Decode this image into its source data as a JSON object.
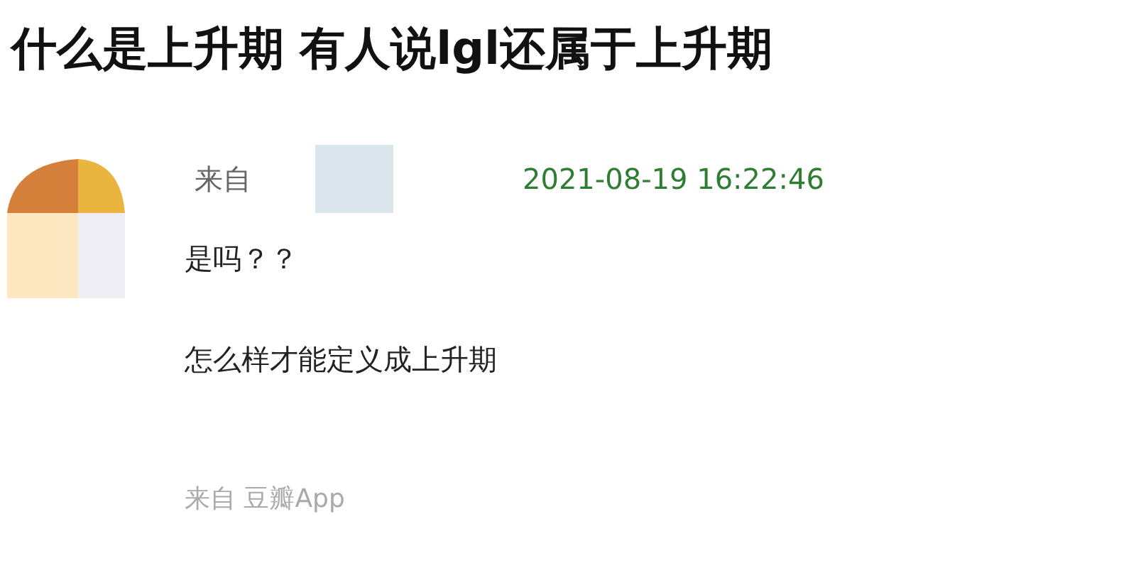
{
  "title": "什么是上升期 有人说lgl还属于上升期",
  "post": {
    "from_label": "来自",
    "timestamp": "2021-08-19 16:22:46",
    "paragraphs": [
      "是吗？？",
      "怎么样才能定义成上升期"
    ],
    "source": "来自 豆瓣App"
  }
}
